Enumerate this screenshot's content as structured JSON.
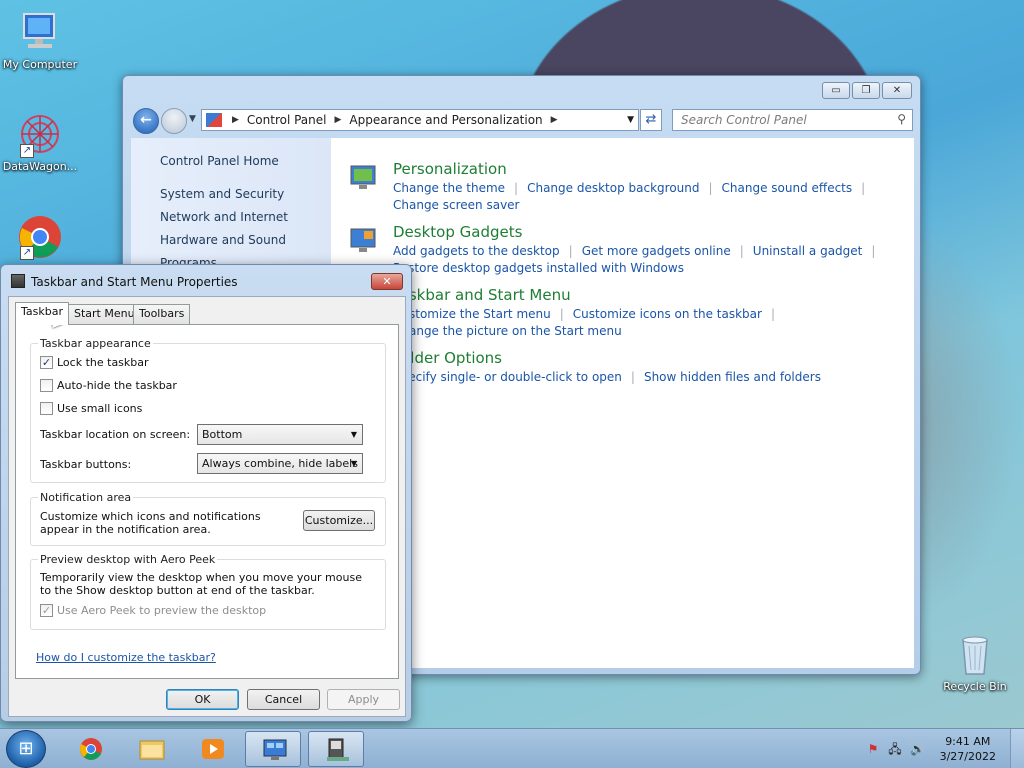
{
  "desktop": {
    "icons": [
      {
        "label": "My Computer"
      },
      {
        "label": "DataWagon..."
      },
      {
        "label": ""
      },
      {
        "label": "Recycle Bin"
      }
    ]
  },
  "control_panel": {
    "address": {
      "crumbs": [
        "Control Panel",
        "Appearance and Personalization"
      ]
    },
    "search_placeholder": "Search Control Panel",
    "left_nav": [
      "Control Panel Home",
      "System and Security",
      "Network and Internet",
      "Hardware and Sound",
      "Programs"
    ],
    "categories": [
      {
        "title": "Personalization",
        "links": [
          "Change the theme",
          "Change desktop background",
          "Change sound effects",
          "Change screen saver"
        ]
      },
      {
        "title": "Desktop Gadgets",
        "links": [
          "Add gadgets to the desktop",
          "Get more gadgets online",
          "Uninstall a gadget",
          "Restore desktop gadgets installed with Windows"
        ]
      },
      {
        "title": "Taskbar and Start Menu",
        "links": [
          "Customize the Start menu",
          "Customize icons on the taskbar",
          "Change the picture on the Start menu"
        ]
      },
      {
        "title": "Folder Options",
        "links": [
          "Specify single- or double-click to open",
          "Show hidden files and folders"
        ]
      }
    ],
    "cat_visible": [
      {
        "title": "Personalization",
        "l1": "Change the theme",
        "l2": "Change desktop background",
        "l3": "Change sound effects",
        "l4": "Change screen saver"
      },
      {
        "title": "Desktop Gadgets",
        "l1": "Add gadgets to the desktop",
        "l2": "Get more gadgets online",
        "l3": "Uninstall a gadget",
        "l4": "Restore desktop gadgets installed with Windows"
      },
      {
        "title": "Taskbar and Start Menu",
        "l1": "Customize the Start menu",
        "l2": "Customize icons on the taskbar",
        "l3": "Change the picture on the Start menu"
      },
      {
        "title": "Folder Options",
        "l1": "Specify single- or double-click to open",
        "l2": "Show hidden files and folders"
      }
    ]
  },
  "dialog": {
    "title": "Taskbar and Start Menu Properties",
    "tabs": [
      "Taskbar",
      "Start Menu",
      "Toolbars"
    ],
    "appearance": {
      "label": "Taskbar appearance",
      "lock": {
        "label": "Lock the taskbar",
        "checked": true
      },
      "autohide": {
        "label": "Auto-hide the taskbar",
        "checked": false
      },
      "small": {
        "label": "Use small icons",
        "checked": false
      },
      "location_label": "Taskbar location on screen:",
      "location_value": "Bottom",
      "buttons_label": "Taskbar buttons:",
      "buttons_value": "Always combine, hide labels"
    },
    "notification": {
      "label": "Notification area",
      "text": "Customize which icons and notifications appear in the notification area.",
      "button": "Customize..."
    },
    "peek": {
      "label": "Preview desktop with Aero Peek",
      "text": "Temporarily view the desktop when you move your mouse to the Show desktop button at end of the taskbar.",
      "checkbox": "Use Aero Peek to preview the desktop",
      "checked": true
    },
    "help_link": "How do I customize the taskbar?",
    "ok": "OK",
    "cancel": "Cancel",
    "apply": "Apply"
  },
  "taskbar": {
    "time": "9:41 AM",
    "date": "3/27/2022"
  }
}
